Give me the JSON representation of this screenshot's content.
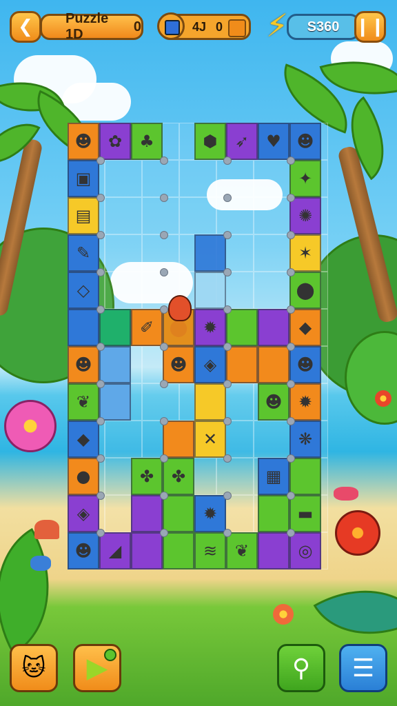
{
  "header": {
    "back_icon": "back-arrow-icon",
    "puzzle_label": "Puzzle 1D",
    "puzzle_count": "0",
    "moves_value": "4J",
    "moves_extra": "0",
    "coins_value": "S360",
    "pause_icon": "pause-icon"
  },
  "colors": {
    "accent_orange": "#f39a22",
    "panel_blue": "#58bfe8",
    "tile_green": "#5cc52e",
    "tile_purple": "#8a3fd1",
    "tile_blue": "#2f78d8",
    "tile_yellow": "#f6c928",
    "tile_orange": "#f28a1c"
  },
  "board": {
    "tiles": [
      {
        "c": "#f28a1c",
        "i": "☻"
      },
      {
        "c": "#8a3fd1",
        "i": "✿"
      },
      {
        "c": "#5cc52e",
        "i": "♣"
      },
      {
        "c": "#5cc52e",
        "i": "⬢"
      },
      {
        "c": "#8a3fd1",
        "i": "➶"
      },
      {
        "c": "#2f78d8",
        "i": "♥"
      },
      {
        "c": "#2f78d8",
        "i": "☻"
      },
      {
        "c": "#2f78d8",
        "i": "▣"
      },
      {
        "c": "#5cc52e",
        "i": "✦"
      },
      {
        "c": "#f6c928",
        "i": "▤"
      },
      {
        "c": "#8a3fd1",
        "i": "✺"
      },
      {
        "c": "#2f78d8",
        "i": "✎"
      },
      {
        "c": "#f6c928",
        "i": "✶"
      },
      {
        "c": "#2f78d8",
        "i": "◇"
      },
      {
        "c": "#5cc52e",
        "i": "⬤"
      },
      {
        "c": "#2f78d8",
        "i": ""
      },
      {
        "c": "#1fb06b",
        "i": ""
      },
      {
        "c": "#5fa8e8",
        "i": ""
      },
      {
        "c": "#f28a1c",
        "i": "✐"
      },
      {
        "c": "#5cc52e",
        "i": "⬤"
      },
      {
        "c": "#8a3fd1",
        "i": "✹"
      },
      {
        "c": "#5cc52e",
        "i": ""
      },
      {
        "c": "#8a3fd1",
        "i": ""
      },
      {
        "c": "#f28a1c",
        "i": "◆"
      },
      {
        "c": "#f28a1c",
        "i": "☻"
      },
      {
        "c": "#5fa8e8",
        "i": ""
      },
      {
        "c": "#f28a1c",
        "i": "☻"
      },
      {
        "c": "#2f78d8",
        "i": "◈"
      },
      {
        "c": "#f28a1c",
        "i": ""
      },
      {
        "c": "#f28a1c",
        "i": ""
      },
      {
        "c": "#2f78d8",
        "i": "☻"
      },
      {
        "c": "#5cc52e",
        "i": "❦"
      },
      {
        "c": "#5fa8e8",
        "i": ""
      },
      {
        "c": "#f6c928",
        "i": ""
      },
      {
        "c": "#5cc52e",
        "i": "☻"
      },
      {
        "c": "#f28a1c",
        "i": "✹"
      },
      {
        "c": "#2f78d8",
        "i": "◆"
      },
      {
        "c": "#f28a1c",
        "i": ""
      },
      {
        "c": "#f6c928",
        "i": "✕"
      },
      {
        "c": "#2f78d8",
        "i": "❋"
      },
      {
        "c": "#f28a1c",
        "i": "●"
      },
      {
        "c": "#5cc52e",
        "i": "✤"
      },
      {
        "c": "#5cc52e",
        "i": "✤"
      },
      {
        "c": "#2f78d8",
        "i": "▦"
      },
      {
        "c": "#5cc52e",
        "i": ""
      },
      {
        "c": "#8a3fd1",
        "i": "◈"
      },
      {
        "c": "#8a3fd1",
        "i": ""
      },
      {
        "c": "#5cc52e",
        "i": ""
      },
      {
        "c": "#2f78d8",
        "i": "✹"
      },
      {
        "c": "#5cc52e",
        "i": ""
      },
      {
        "c": "#5cc52e",
        "i": "▬"
      },
      {
        "c": "#2f78d8",
        "i": "☻"
      },
      {
        "c": "#8a3fd1",
        "i": "◢"
      },
      {
        "c": "#8a3fd1",
        "i": ""
      },
      {
        "c": "#5cc52e",
        "i": ""
      },
      {
        "c": "#5cc52e",
        "i": "≋"
      },
      {
        "c": "#5cc52e",
        "i": "❦"
      },
      {
        "c": "#8a3fd1",
        "i": ""
      },
      {
        "c": "#8a3fd1",
        "i": "◎"
      }
    ]
  },
  "footer": {
    "face_icon": "cat-face-icon",
    "play_icon": "play-icon",
    "hint_icon": "magnifier-hint-icon",
    "menu_icon": "menu-list-icon"
  }
}
